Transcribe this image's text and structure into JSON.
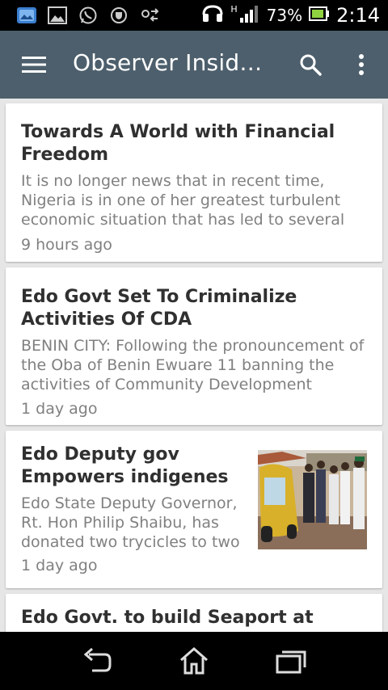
{
  "status_bar": {
    "battery": "73%",
    "time": "2:14",
    "network_type": "H",
    "icons": [
      "gallery-app-icon",
      "image-icon",
      "whatsapp-icon",
      "shield-icon",
      "sync-icon",
      "headset-icon",
      "signal-icon",
      "battery-icon"
    ]
  },
  "app_bar": {
    "title": "Observer Inside...",
    "background": "#4d5f6c",
    "menu_icon": "hamburger-menu-icon",
    "search_icon": "search-icon",
    "more_icon": "more-vert-icon"
  },
  "articles": [
    {
      "title": "Towards A World with Financial Freedom",
      "summary": "It is no longer news that in recent time, Nigeria is in one of her greatest turbulent economic situation that has led to several",
      "time": "9 hours ago"
    },
    {
      "title": "Edo Govt Set To Criminalize Activities Of CDA",
      "summary": "BENIN CITY: Following the pronouncement of the Oba of Benin Ewuare 11 banning the activities of Community Development",
      "time": "1 day ago"
    },
    {
      "title": "Edo Deputy gov Empowers indigenes",
      "summary": "Edo State Deputy Governor, Rt. Hon Philip Shaibu, has donated two trycicles to two",
      "time": "1 day ago",
      "thumbnail": "tricycle-photo"
    },
    {
      "title": "Edo Govt. to build Seaport at"
    }
  ],
  "nav_bar": {
    "icons": [
      "back-icon",
      "home-icon",
      "recents-icon"
    ]
  }
}
